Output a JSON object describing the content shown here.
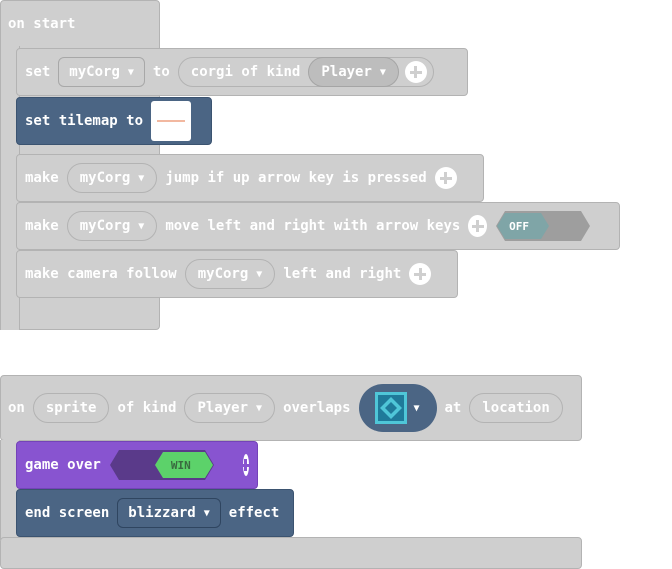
{
  "on_start_block": {
    "label": "on start",
    "rows": {
      "set": {
        "label": "set",
        "variable": "myCorg",
        "to": "to",
        "sprite_text": "corgi of kind",
        "kind": "Player"
      },
      "tilemap": {
        "label": "set tilemap to"
      },
      "jump": {
        "make": "make",
        "variable": "myCorg",
        "text": "jump if up arrow key is pressed"
      },
      "move": {
        "make": "make",
        "variable": "myCorg",
        "text": "move left and right with arrow keys",
        "toggle": "OFF"
      },
      "camera": {
        "label": "make camera follow",
        "variable": "myCorg",
        "text": "left and right"
      }
    }
  },
  "overlap_block": {
    "on": "on",
    "sprite": "sprite",
    "of_kind": "of kind",
    "kind": "Player",
    "overlaps": "overlaps",
    "at": "at",
    "location": "location",
    "game_over": {
      "label": "game over",
      "toggle": "WIN"
    },
    "end_screen": {
      "label": "end screen",
      "effect": "blizzard",
      "suffix": "effect"
    }
  },
  "colors": {
    "grey_block": "#cfcfcf",
    "blue_block": "#4b6584",
    "purple_block": "#8854d0",
    "win_green": "#5cd26a",
    "off_teal": "#7fa5a7"
  }
}
